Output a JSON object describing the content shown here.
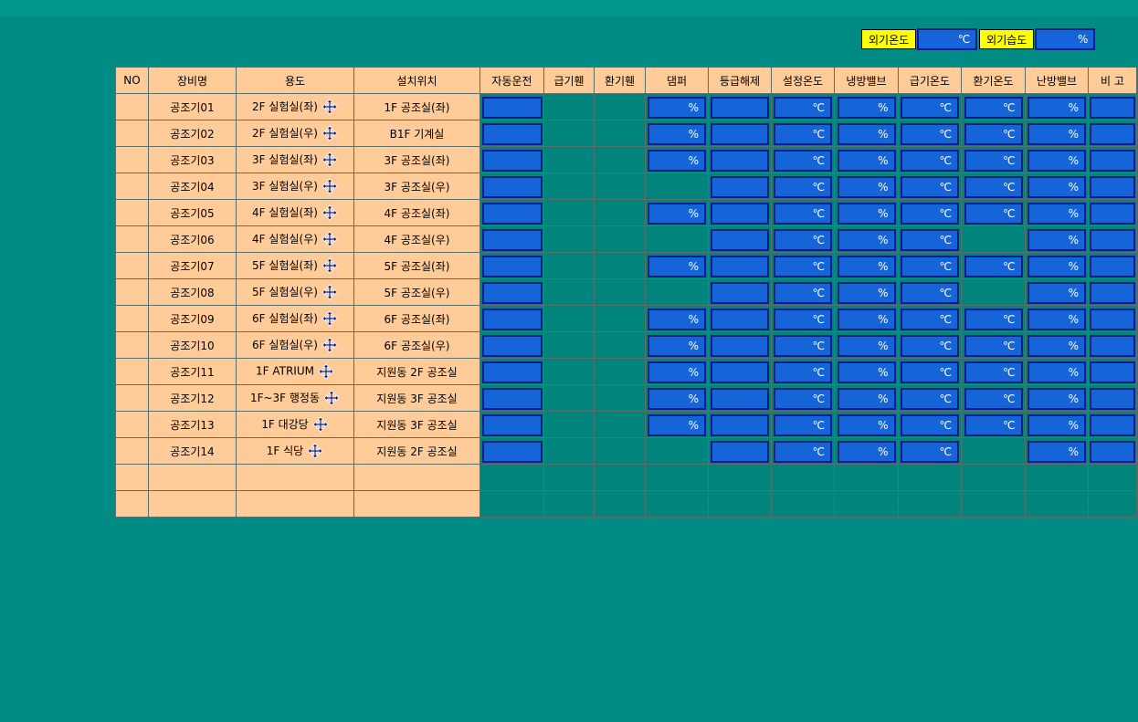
{
  "outside": {
    "temp_label": "외기온도",
    "temp_unit": "℃",
    "hum_label": "외기습도",
    "hum_unit": "%"
  },
  "headers": [
    "NO",
    "장비명",
    "용도",
    "설치위치",
    "자동운전",
    "급기휀",
    "환기휀",
    "댐퍼",
    "등급해제",
    "설정온도",
    "냉방밸브",
    "급기온도",
    "환기온도",
    "난방밸브",
    "비 고"
  ],
  "units": {
    "percent": "%",
    "celsius": "℃"
  },
  "rows": [
    {
      "name": "공조기01",
      "use": "2F 실험실(좌)",
      "loc": "1F 공조실(좌)",
      "damper": true,
      "cool": true,
      "ret": true,
      "heat": true
    },
    {
      "name": "공조기02",
      "use": "2F 실험실(우)",
      "loc": "B1F 기계실",
      "damper": true,
      "cool": true,
      "ret": true,
      "heat": true
    },
    {
      "name": "공조기03",
      "use": "3F 실험실(좌)",
      "loc": "3F 공조실(좌)",
      "damper": true,
      "cool": true,
      "ret": true,
      "heat": true
    },
    {
      "name": "공조기04",
      "use": "3F 실험실(우)",
      "loc": "3F 공조실(우)",
      "damper": false,
      "cool": true,
      "ret": true,
      "heat": true
    },
    {
      "name": "공조기05",
      "use": "4F 실험실(좌)",
      "loc": "4F 공조실(좌)",
      "damper": true,
      "cool": true,
      "ret": true,
      "heat": true
    },
    {
      "name": "공조기06",
      "use": "4F 실험실(우)",
      "loc": "4F 공조실(우)",
      "damper": false,
      "cool": true,
      "ret": false,
      "heat": true
    },
    {
      "name": "공조기07",
      "use": "5F 실험실(좌)",
      "loc": "5F 공조실(좌)",
      "damper": true,
      "cool": true,
      "ret": true,
      "heat": true
    },
    {
      "name": "공조기08",
      "use": "5F 실험실(우)",
      "loc": "5F 공조실(우)",
      "damper": false,
      "cool": true,
      "ret": false,
      "heat": true
    },
    {
      "name": "공조기09",
      "use": "6F 실험실(좌)",
      "loc": "6F 공조실(좌)",
      "damper": true,
      "cool": true,
      "ret": true,
      "heat": true
    },
    {
      "name": "공조기10",
      "use": "6F 실험실(우)",
      "loc": "6F 공조실(우)",
      "damper": true,
      "cool": true,
      "ret": true,
      "heat": true
    },
    {
      "name": "공조기11",
      "use": "1F ATRIUM",
      "loc": "지원동 2F 공조실",
      "damper": true,
      "cool": true,
      "ret": true,
      "heat": true
    },
    {
      "name": "공조기12",
      "use": "1F~3F 행정동",
      "loc": "지원동 3F 공조실",
      "damper": true,
      "cool": true,
      "ret": true,
      "heat": true
    },
    {
      "name": "공조기13",
      "use": "1F 대강당",
      "loc": "지원동 3F 공조실",
      "damper": true,
      "cool": true,
      "ret": true,
      "heat": true
    },
    {
      "name": "공조기14",
      "use": "1F 식당",
      "loc": "지원동 2F 공조실",
      "damper": false,
      "cool": true,
      "ret": false,
      "heat": true
    }
  ],
  "empty_rows": 2
}
